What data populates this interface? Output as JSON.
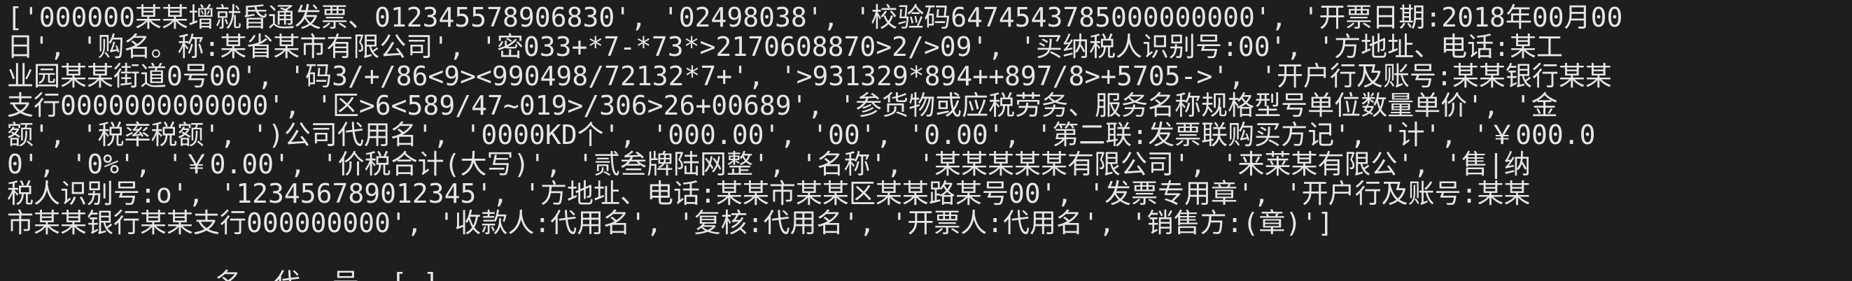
{
  "terminal": {
    "lines": [
      "['000000某某增就昏通发票、012345578906830', '02498038', '校验码6474543785000000000', '开票日期:2018年00月00",
      "日', '购名。称:某省某市有限公司', '密033+*7-*73*>2170608870>2/>09', '买纳税人识别号:00', '方地址、电话:某工",
      "业园某某街道0号00', '码3/+/86<9><990498/72132*7+', '>931329*894++897/8>+5705->', '开户行及账号:某某银行某某",
      "支行0000000000000', '区>6<589/47~019>/306>26+00689', '参货物或应税劳务、服务名称规格型号单位数量单价', '金",
      "额', '税率税额', ')公司代用名', '0000KD个', '000.00', '00', '0.00', '第二联:发票联购买方记', '计', '￥000.0",
      "0', '0%', '￥0.00', '价税合计(大写)', '贰叁牌陆网整', '名称', '某某某某某有限公司', '来莱某有限公', '售|纳",
      "税人识别号:o', '123456789012345', '方地址、电话:某某市某某区某某路某号00', '发票专用章', '开户行及账号:某某",
      "市某某银行某某支行000000000', '收款人:代用名', '复核:代用名', '开票人:代用名', '销售方:(章)']"
    ],
    "partial_line": "             名  代  号  [ ]"
  }
}
